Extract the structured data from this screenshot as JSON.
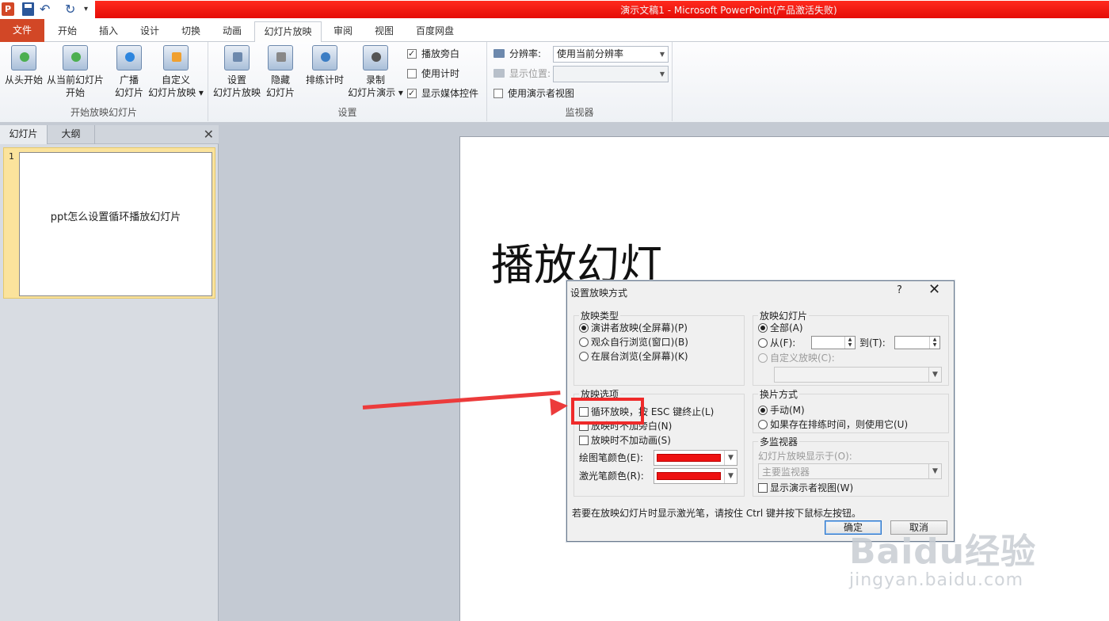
{
  "window": {
    "title": "演示文稿1 - Microsoft PowerPoint(产品激活失败)"
  },
  "tabs": [
    "文件",
    "开始",
    "插入",
    "设计",
    "切换",
    "动画",
    "幻灯片放映",
    "审阅",
    "视图",
    "百度网盘"
  ],
  "ribbon": {
    "start_group": {
      "label": "开始放映幻灯片",
      "from_beginning": "从头开始",
      "from_current_l1": "从当前幻灯片",
      "from_current_l2": "开始",
      "broadcast_l1": "广播",
      "broadcast_l2": "幻灯片",
      "custom_l1": "自定义",
      "custom_l2": "幻灯片放映 ▾"
    },
    "setup_group": {
      "label": "设置",
      "setup_l1": "设置",
      "setup_l2": "幻灯片放映",
      "hide_l1": "隐藏",
      "hide_l2": "幻灯片",
      "rehearse": "排练计时",
      "record_l1": "录制",
      "record_l2": "幻灯片演示 ▾",
      "play_narrations": "播放旁白",
      "use_timings": "使用计时",
      "show_media_controls": "显示媒体控件"
    },
    "monitors_group": {
      "label": "监视器",
      "resolution_label": "分辨率:",
      "resolution_value": "使用当前分辨率",
      "show_on_label": "显示位置:",
      "presenter_view": "使用演示者视图"
    }
  },
  "left_pane": {
    "tab_slides": "幻灯片",
    "tab_outline": "大纲",
    "slide_number": "1",
    "thumb_text": "ppt怎么设置循环播放幻灯片"
  },
  "slide": {
    "visible_title": "播放幻灯"
  },
  "dialog": {
    "title": "设置放映方式",
    "help": "?",
    "close": "✕",
    "show_type": {
      "label": "放映类型",
      "options": [
        "演讲者放映(全屏幕)(P)",
        "观众自行浏览(窗口)(B)",
        "在展台浏览(全屏幕)(K)"
      ]
    },
    "show_slides": {
      "label": "放映幻灯片",
      "all": "全部(A)",
      "from": "从(F):",
      "to": "到(T):",
      "custom": "自定义放映(C):"
    },
    "show_options": {
      "label": "放映选项",
      "loop": "循环放映，按 ESC 键终止(L)",
      "no_narration": "放映时不加旁白(N)",
      "no_animation": "放映时不加动画(S)",
      "pen_color": "绘图笔颜色(E):",
      "laser_color": "激光笔颜色(R):"
    },
    "advance": {
      "label": "换片方式",
      "manual": "手动(M)",
      "timings": "如果存在排练时间，则使用它(U)"
    },
    "monitors": {
      "label": "多监视器",
      "display_on": "幻灯片放映显示于(O):",
      "display_value": "主要监视器",
      "presenter_view": "显示演示者视图(W)"
    },
    "hint": "若要在放映幻灯片时显示激光笔，请按住 Ctrl 键并按下鼠标左按钮。",
    "ok": "确定",
    "cancel": "取消"
  },
  "watermark": {
    "main": "Baidu经验",
    "sub": "jingyan.baidu.com"
  }
}
